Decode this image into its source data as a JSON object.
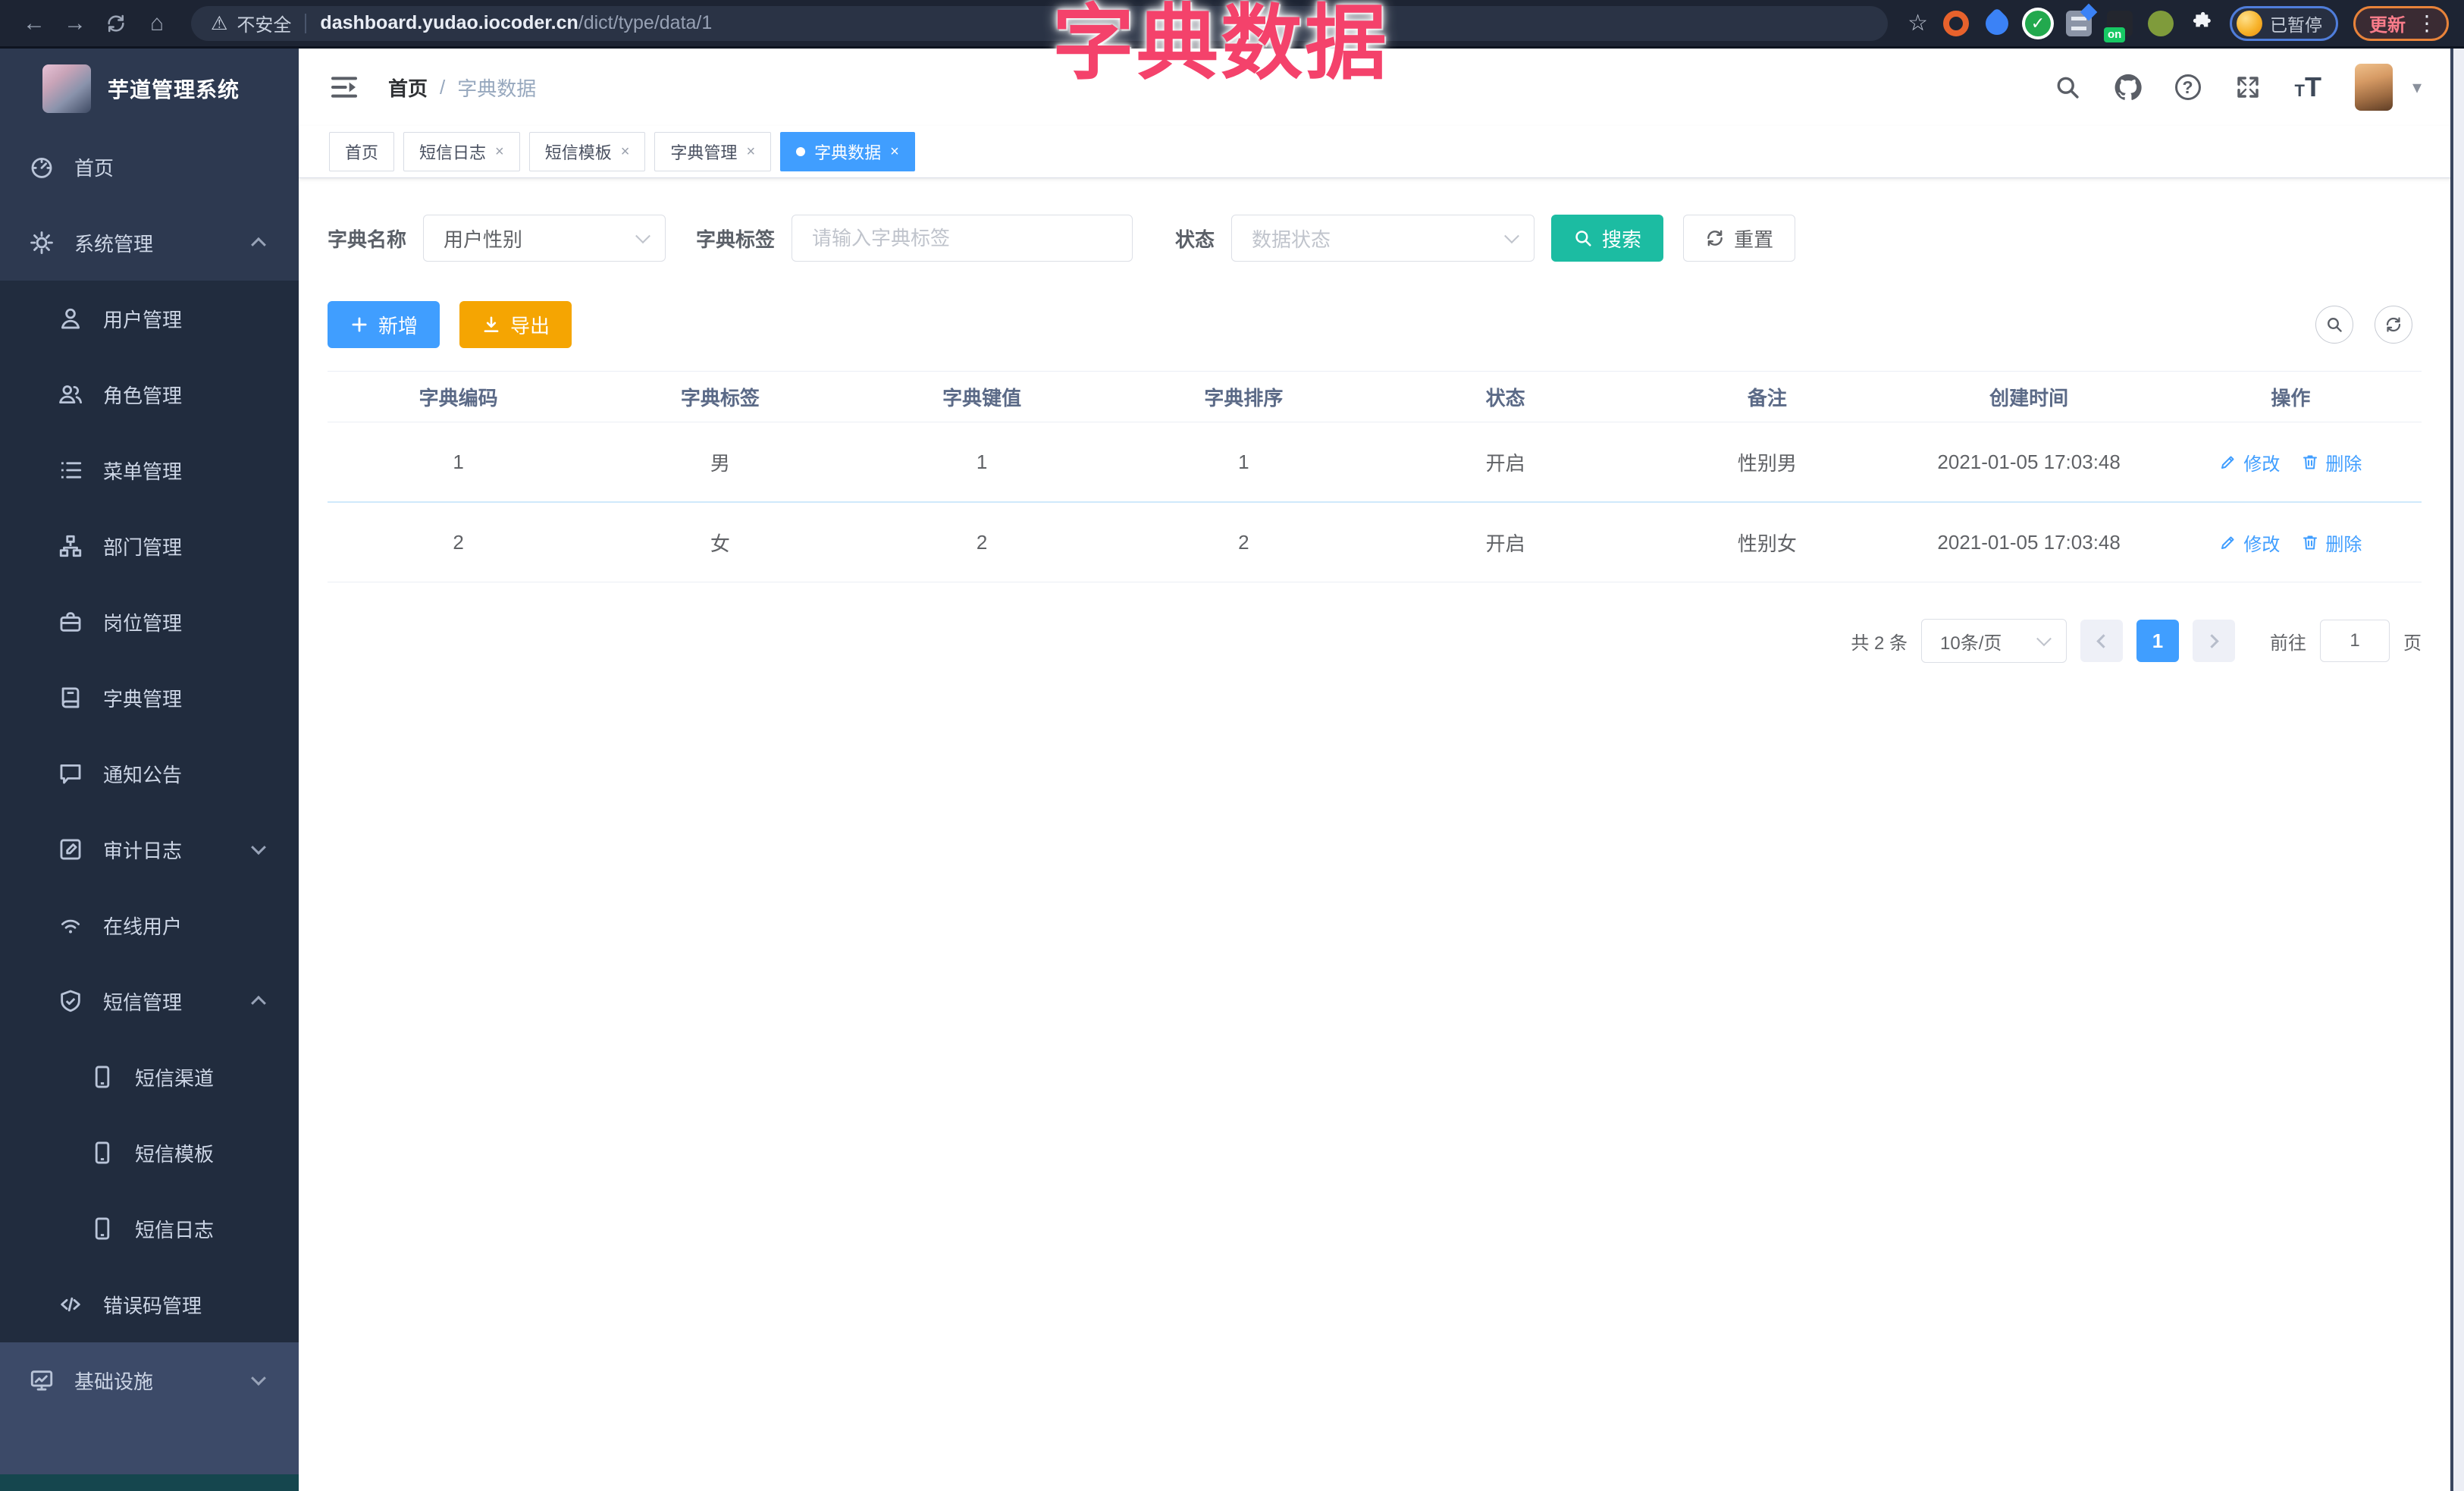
{
  "overlay": {
    "title": "字典数据"
  },
  "browser": {
    "security": "不安全",
    "url_host": "dashboard.yudao.iocoder.cn",
    "url_path": "/dict/type/data/1",
    "ext_on_badge": "on",
    "profile_status": "已暂停",
    "update_label": "更新"
  },
  "sidebar": {
    "logo_title": "芋道管理系统",
    "items": [
      {
        "label": "首页"
      },
      {
        "label": "系统管理"
      },
      {
        "label": "用户管理"
      },
      {
        "label": "角色管理"
      },
      {
        "label": "菜单管理"
      },
      {
        "label": "部门管理"
      },
      {
        "label": "岗位管理"
      },
      {
        "label": "字典管理"
      },
      {
        "label": "通知公告"
      },
      {
        "label": "审计日志"
      },
      {
        "label": "在线用户"
      },
      {
        "label": "短信管理"
      },
      {
        "label": "短信渠道"
      },
      {
        "label": "短信模板"
      },
      {
        "label": "短信日志"
      },
      {
        "label": "错误码管理"
      },
      {
        "label": "基础设施"
      }
    ]
  },
  "header": {
    "breadcrumb_home": "首页",
    "breadcrumb_sep": "/",
    "breadcrumb_current": "字典数据"
  },
  "tabs": [
    {
      "label": "首页"
    },
    {
      "label": "短信日志"
    },
    {
      "label": "短信模板"
    },
    {
      "label": "字典管理"
    },
    {
      "label": "字典数据"
    }
  ],
  "filters": {
    "dict_name_label": "字典名称",
    "dict_name_value": "用户性别",
    "dict_label_label": "字典标签",
    "dict_label_placeholder": "请输入字典标签",
    "status_label": "状态",
    "status_placeholder": "数据状态",
    "search_button": "搜索",
    "reset_button": "重置"
  },
  "toolbar": {
    "add_button": "新增",
    "export_button": "导出"
  },
  "table": {
    "headers": [
      "字典编码",
      "字典标签",
      "字典键值",
      "字典排序",
      "状态",
      "备注",
      "创建时间",
      "操作"
    ],
    "rows": [
      {
        "code": "1",
        "label": "男",
        "value": "1",
        "sort": "1",
        "status": "开启",
        "remark": "性别男",
        "created": "2021-01-05 17:03:48"
      },
      {
        "code": "2",
        "label": "女",
        "value": "2",
        "sort": "2",
        "status": "开启",
        "remark": "性别女",
        "created": "2021-01-05 17:03:48"
      }
    ],
    "ops": {
      "edit": "修改",
      "delete": "删除"
    }
  },
  "pagination": {
    "total": "共 2 条",
    "page_size": "10条/页",
    "current": "1",
    "goto": "前往",
    "goto_value": "1",
    "unit": "页"
  },
  "colors": {
    "primary": "#409EFF",
    "search_teal": "#1CBCA2",
    "export_orange": "#F5A502",
    "annotation_pink": "#F4426B",
    "sidebar_bg": "#2D3950",
    "sidebar_submenu_bg": "#212C3E",
    "sidebar_bottom_bg": "#3C4A68",
    "browser_bar_bg": "#1D2433"
  }
}
